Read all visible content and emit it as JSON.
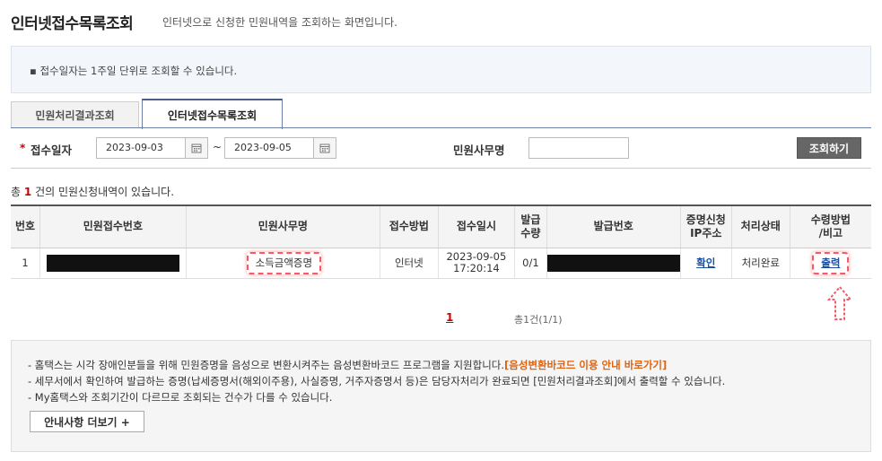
{
  "header": {
    "title": "인터넷접수목록조회",
    "description": "인터넷으로 신청한 민원내역을 조회하는 화면입니다."
  },
  "notice": {
    "text": "접수일자는 1주일 단위로 조회할 수 있습니다."
  },
  "tabs": [
    {
      "label": "민원처리결과조회",
      "active": false
    },
    {
      "label": "인터넷접수목록조회",
      "active": true
    }
  ],
  "search": {
    "date_label": "접수일자",
    "date_from": "2023-09-03",
    "date_to": "2023-09-05",
    "separator": "~",
    "office_label": "민원사무명",
    "office_value": "",
    "search_button": "조회하기"
  },
  "count": {
    "prefix": "총",
    "number": "1",
    "suffix": "건의 민원신청내역이 있습니다."
  },
  "table": {
    "headers": [
      "번호",
      "민원접수번호",
      "민원사무명",
      "접수방법",
      "접수일시",
      "발급\n수량",
      "발급번호",
      "증명신청\nIP주소",
      "처리상태",
      "수령방법\n/비고"
    ],
    "rows": [
      {
        "no": "1",
        "receipt_no": "",
        "office": "소득금액증명",
        "method": "인터넷",
        "date": "2023-09-05",
        "time": "17:20:14",
        "qty": "0/1",
        "issue_no": "",
        "ip": "확인",
        "status": "처리완료",
        "receive": "출력"
      }
    ]
  },
  "pager": {
    "current": "1",
    "info": "총1건(1/1)"
  },
  "info": {
    "line1": "- 홈택스는 시각 장애인분들을 위해 민원증명을 음성으로 변환시켜주는 음성변환바코드 프로그램을 지원합니다.",
    "line1_link": "[음성변환바코드 이용 안내 바로가기]",
    "line2": "- 세무서에서 확인하여 발급하는 증명(납세증명서(해외이주용), 사실증명, 거주자증명서 등)은 담당자처리가 완료되면 [민원처리결과조회]에서 출력할 수 있습니다.",
    "line3": "- My홈택스와 조회기간이 다르므로 조회되는 건수가 다를 수 있습니다.",
    "more_button": "안내사항 더보기 +"
  }
}
